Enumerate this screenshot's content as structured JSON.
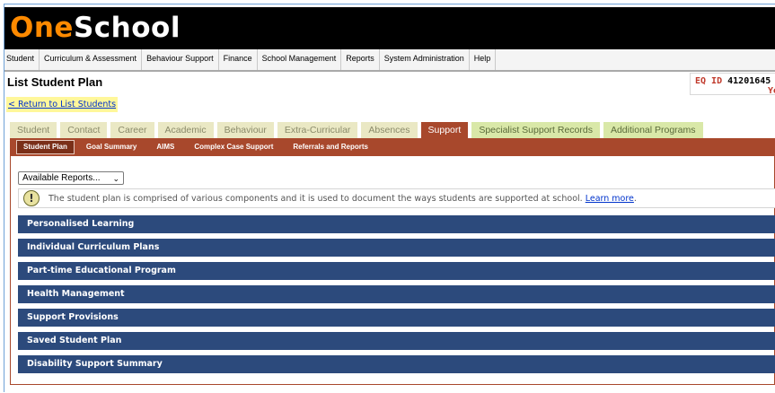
{
  "logo": {
    "part1": "One",
    "part2": "School"
  },
  "mainnav": [
    "Student",
    "Curriculum & Assessment",
    "Behaviour Support",
    "Finance",
    "School Management",
    "Reports",
    "System Administration",
    "Help"
  ],
  "page_title": "List Student Plan",
  "eq": {
    "label": "EQ ID",
    "value": "41201645",
    "year": "Ye"
  },
  "return_link": "< Return to List Students",
  "tabs": [
    "Student",
    "Contact",
    "Career",
    "Academic",
    "Behaviour",
    "Extra-Curricular",
    "Absences",
    "Support",
    "Specialist Support Records",
    "Additional Programs"
  ],
  "subnav": [
    "Student Plan",
    "Goal Summary",
    "AIMS",
    "Complex Case Support",
    "Referrals and Reports"
  ],
  "reports_select": "Available Reports...",
  "info": {
    "text": "The student plan is comprised of various components and it is used to document the ways students are supported at school.",
    "link": "Learn more",
    "tail": "."
  },
  "sections": [
    "Personalised Learning",
    "Individual Curriculum Plans",
    "Part-time Educational Program",
    "Health Management",
    "Support Provisions",
    "Saved Student Plan",
    "Disability Support Summary"
  ],
  "colors": {
    "brand_orange": "#ff8a00",
    "tab_active": "#a8482c",
    "section_blue": "#2c4a7c",
    "link": "#0033cc"
  },
  "icons": {
    "info": "exclamation-circle-icon",
    "dropdown": "chevron-down-icon"
  }
}
